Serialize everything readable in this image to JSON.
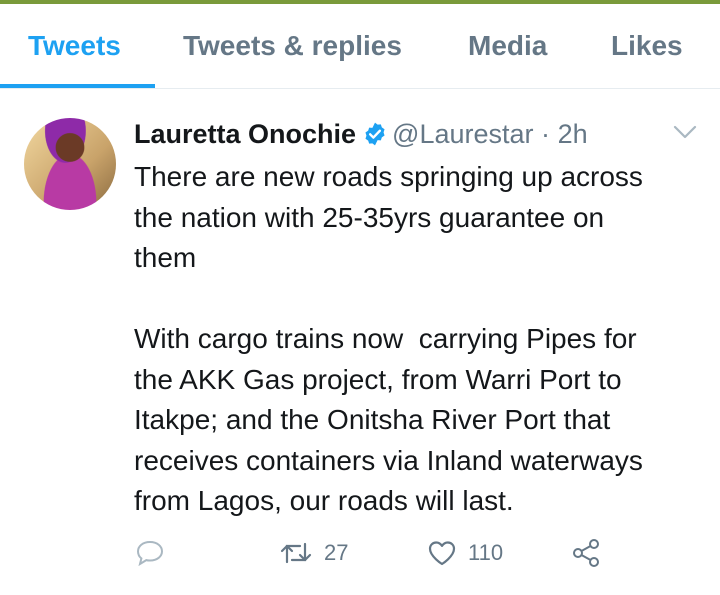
{
  "tabs": [
    {
      "label": "Tweets",
      "active": true
    },
    {
      "label": "Tweets & replies",
      "active": false
    },
    {
      "label": "Media",
      "active": false
    },
    {
      "label": "Likes",
      "active": false
    }
  ],
  "tweet": {
    "author_name": "Lauretta Onochie",
    "verified": true,
    "handle": "@Laurestar",
    "separator": "·",
    "time": "2h",
    "text": "There are new roads springing up across\nthe nation with 25-35yrs guarantee on\nthem\n\nWith cargo trains now  carrying Pipes for\nthe AKK Gas project, from Warri Port to\nItakpe; and the Onitsha River Port that\nreceives containers via Inland waterways\nfrom Lagos, our roads will last.",
    "actions": {
      "reply_icon": "reply-icon",
      "retweet_icon": "retweet-icon",
      "retweet_count": "27",
      "like_icon": "heart-icon",
      "like_count": "110",
      "share_icon": "share-icon"
    }
  },
  "colors": {
    "accent": "#1da1f2",
    "muted": "#657786",
    "text": "#14171a",
    "verified_badge": "#1da1f2"
  }
}
